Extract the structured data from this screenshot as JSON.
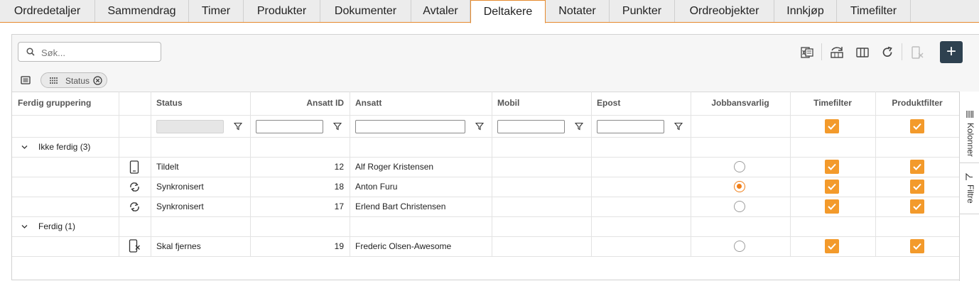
{
  "tabs": [
    {
      "label": "Ordredetaljer",
      "active": false
    },
    {
      "label": "Sammendrag",
      "active": false
    },
    {
      "label": "Timer",
      "active": false
    },
    {
      "label": "Produkter",
      "active": false
    },
    {
      "label": "Dokumenter",
      "active": false
    },
    {
      "label": "Avtaler",
      "active": false
    },
    {
      "label": "Deltakere",
      "active": true
    },
    {
      "label": "Notater",
      "active": false
    },
    {
      "label": "Punkter",
      "active": false
    },
    {
      "label": "Ordreobjekter",
      "active": false
    },
    {
      "label": "Innkjøp",
      "active": false
    },
    {
      "label": "Timefilter",
      "active": false
    }
  ],
  "search": {
    "placeholder": "Søk...",
    "value": ""
  },
  "toolbar": {
    "icons": [
      "excel-export-icon",
      "group-rows-icon",
      "columns-icon",
      "refresh-icon",
      "remove-device-icon"
    ],
    "add_label": "+"
  },
  "grouping": {
    "chip_label": "Status"
  },
  "grid": {
    "columns": [
      "Ferdig gruppering",
      "",
      "Status",
      "Ansatt ID",
      "Ansatt",
      "Mobil",
      "Epost",
      "Jobbansvarlig",
      "Timefilter",
      "Produktfilter"
    ],
    "groups": [
      {
        "label": "Ikke ferdig (3)",
        "rows": [
          {
            "icon": "mobile-phone-icon",
            "status": "Tildelt",
            "ansatt_id": "12",
            "ansatt": "Alf Roger Kristensen",
            "mobil": "",
            "epost": "",
            "jobbansvarlig": false,
            "timefilter": true,
            "produktfilter": true
          },
          {
            "icon": "sync-icon",
            "status": "Synkronisert",
            "ansatt_id": "18",
            "ansatt": "Anton Furu",
            "mobil": "",
            "epost": "",
            "jobbansvarlig": true,
            "timefilter": true,
            "produktfilter": true
          },
          {
            "icon": "sync-icon",
            "status": "Synkronisert",
            "ansatt_id": "17",
            "ansatt": "Erlend Bart Christensen",
            "mobil": "",
            "epost": "",
            "jobbansvarlig": false,
            "timefilter": true,
            "produktfilter": true
          }
        ]
      },
      {
        "label": "Ferdig (1)",
        "rows": [
          {
            "icon": "remove-device-icon",
            "status": "Skal fjernes",
            "ansatt_id": "19",
            "ansatt": "Frederic Olsen-Awesome",
            "mobil": "",
            "epost": "",
            "jobbansvarlig": false,
            "timefilter": true,
            "produktfilter": true
          }
        ]
      }
    ]
  },
  "side_panel": {
    "columns_label": "Kolonner",
    "filters_label": "Filtre"
  },
  "colors": {
    "accent": "#f39a2b",
    "tab_border": "#e58a2e",
    "add_button": "#2e4150"
  }
}
